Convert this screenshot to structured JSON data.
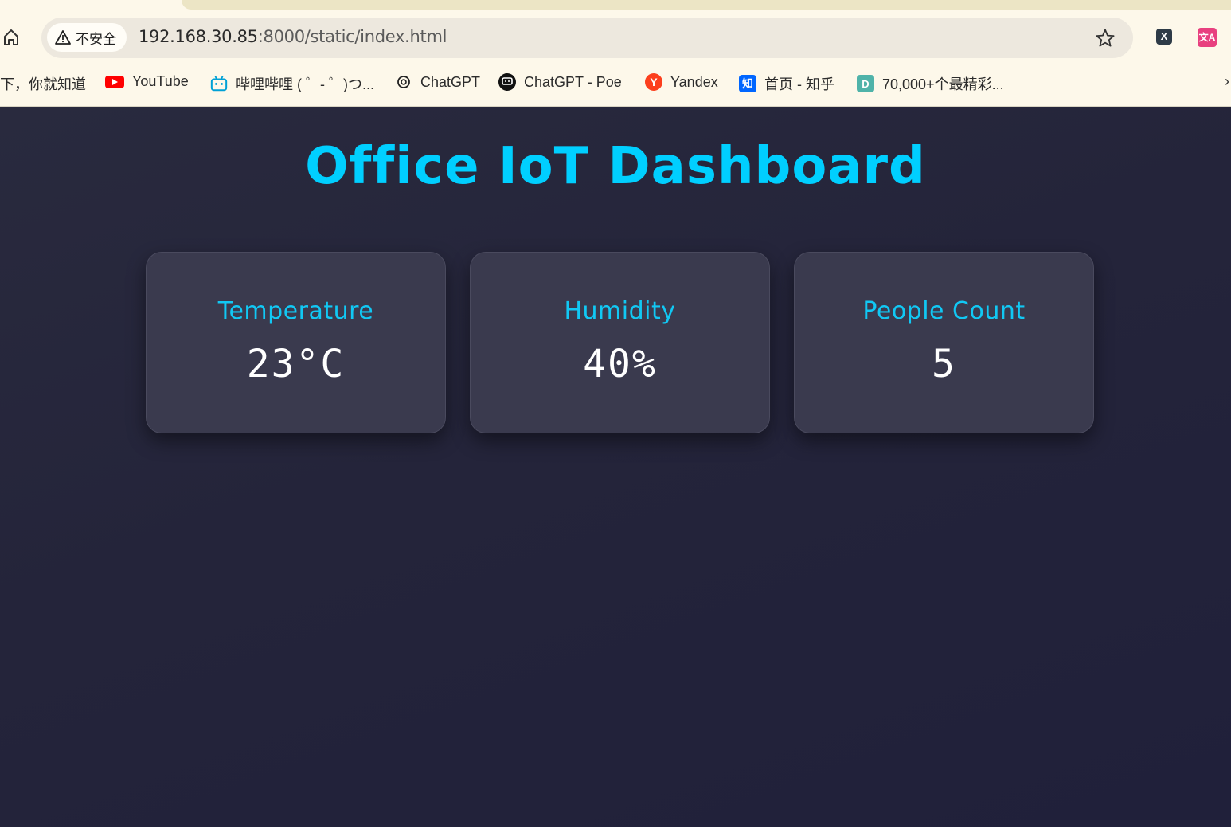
{
  "browser": {
    "security_label": "不安全",
    "url_host": "192.168.30.85",
    "url_rest": ":8000/static/index.html",
    "extensions": [
      {
        "name": "x-extension",
        "glyph": "X",
        "color": "#2e3b47"
      },
      {
        "name": "translate-extension",
        "glyph": "文A",
        "color": "#e8407f"
      }
    ],
    "bookmarks": [
      {
        "label": "下，你就知道",
        "icon": "none"
      },
      {
        "label": "YouTube",
        "icon": "youtube-icon",
        "color": "#ff0000"
      },
      {
        "label": "哔哩哔哩 ( ゜- ゜)つ...",
        "icon": "bilibili-icon",
        "color": "#00a1d6"
      },
      {
        "label": "ChatGPT",
        "icon": "openai-icon",
        "color": "#222222"
      },
      {
        "label": "ChatGPT - Poe",
        "icon": "poe-icon",
        "color": "#111111"
      },
      {
        "label": "Yandex",
        "icon": "yandex-icon",
        "color": "#fc3f1d"
      },
      {
        "label": "首页 - 知乎",
        "icon": "zhihu-icon",
        "glyph": "知",
        "color": "#0066ff"
      },
      {
        "label": "70,000+个最精彩...",
        "icon": "d-icon",
        "glyph": "D",
        "color": "#4fb3a9"
      }
    ],
    "more_glyph": "›"
  },
  "page": {
    "title": "Office IoT Dashboard",
    "cards": [
      {
        "label": "Temperature",
        "value": "23°C"
      },
      {
        "label": "Humidity",
        "value": "40%"
      },
      {
        "label": "People Count",
        "value": "5"
      }
    ]
  },
  "colors": {
    "accent": "#00cfff",
    "page_background": "#232336",
    "card_background": "#3a3a4e",
    "value_text": "#ffffff"
  }
}
